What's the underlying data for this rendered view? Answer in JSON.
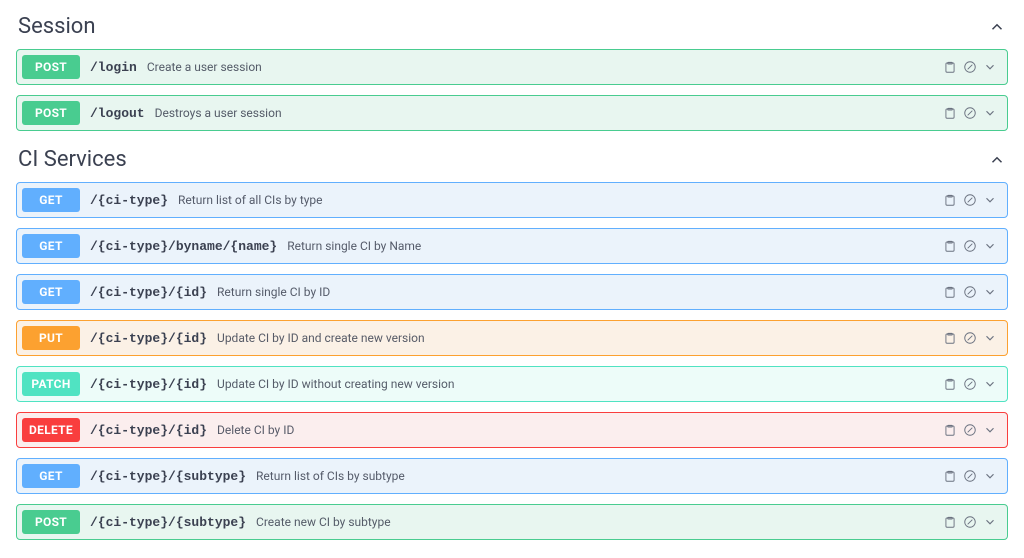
{
  "sections": [
    {
      "title": "Session",
      "ops": [
        {
          "method": "POST",
          "path": "/login",
          "desc": "Create a user session"
        },
        {
          "method": "POST",
          "path": "/logout",
          "desc": "Destroys a user session"
        }
      ]
    },
    {
      "title": "CI Services",
      "ops": [
        {
          "method": "GET",
          "path": "/{ci-type}",
          "desc": "Return list of all CIs by type"
        },
        {
          "method": "GET",
          "path": "/{ci-type}/byname/{name}",
          "desc": "Return single CI by Name"
        },
        {
          "method": "GET",
          "path": "/{ci-type}/{id}",
          "desc": "Return single CI by ID"
        },
        {
          "method": "PUT",
          "path": "/{ci-type}/{id}",
          "desc": "Update CI by ID and create new version"
        },
        {
          "method": "PATCH",
          "path": "/{ci-type}/{id}",
          "desc": "Update CI by ID without creating new version"
        },
        {
          "method": "DELETE",
          "path": "/{ci-type}/{id}",
          "desc": "Delete CI by ID"
        },
        {
          "method": "GET",
          "path": "/{ci-type}/{subtype}",
          "desc": "Return list of CIs by subtype"
        },
        {
          "method": "POST",
          "path": "/{ci-type}/{subtype}",
          "desc": "Create new CI by subtype"
        }
      ]
    }
  ]
}
